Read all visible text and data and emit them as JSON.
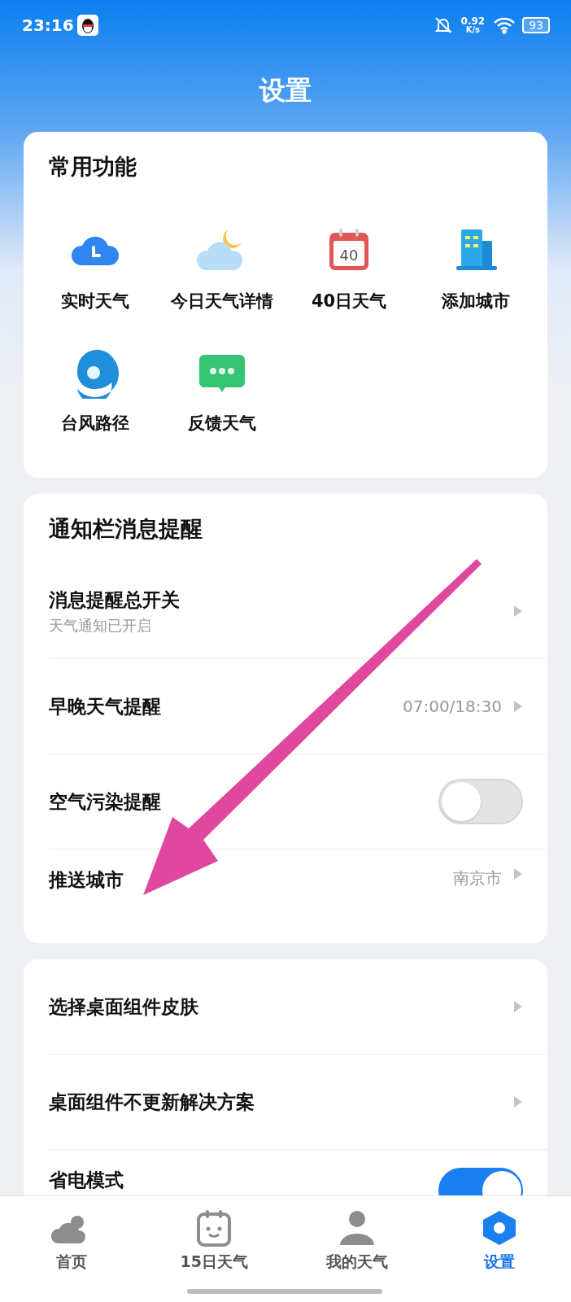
{
  "status_bar": {
    "time": "23:16",
    "net_speed": "0.92",
    "net_unit": "K/s",
    "battery": "93"
  },
  "title": "设置",
  "quick": {
    "title": "常用功能",
    "items": [
      {
        "label": "实时天气"
      },
      {
        "label": "今日天气详情"
      },
      {
        "label": "40日天气",
        "icon_text": "40"
      },
      {
        "label": "添加城市"
      },
      {
        "label": "台风路径"
      },
      {
        "label": "反馈天气"
      }
    ]
  },
  "cards": [
    {
      "title": "通知栏消息提醒",
      "rows": [
        {
          "label": "消息提醒总开关",
          "subtitle": "天气通知已开启",
          "kind": "arrow"
        },
        {
          "label": "早晚天气提醒",
          "value": "07:00/18:30",
          "kind": "arrow"
        },
        {
          "label": "空气污染提醒",
          "kind": "toggle",
          "on": false
        },
        {
          "label": "推送城市",
          "value": "南京市",
          "kind": "arrow"
        }
      ]
    },
    {
      "rows": [
        {
          "label": "选择桌面组件皮肤",
          "kind": "arrow"
        },
        {
          "label": "桌面组件不更新解决方案",
          "kind": "arrow"
        },
        {
          "label": "省电模式",
          "kind": "toggle",
          "on": true
        }
      ]
    }
  ],
  "nav": [
    {
      "label": "首页",
      "selected": false
    },
    {
      "label": "15日天气",
      "selected": false
    },
    {
      "label": "我的天气",
      "selected": false
    },
    {
      "label": "设置",
      "selected": true
    }
  ]
}
